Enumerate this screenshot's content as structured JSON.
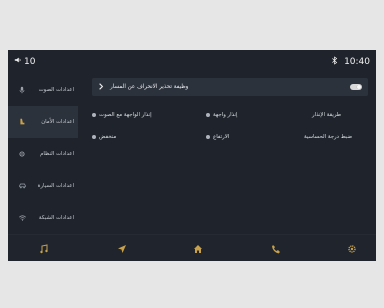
{
  "status": {
    "volume": "10",
    "time": "10:40",
    "icons": [
      "speaker-icon",
      "bluetooth-icon"
    ]
  },
  "sidebar": {
    "items": [
      {
        "label": "اعدادات الصوت",
        "icon": "microphone-icon",
        "active": false
      },
      {
        "label": "اعدادات الأمان",
        "icon": "seat-icon",
        "active": true
      },
      {
        "label": "اعدادات النظام",
        "icon": "gear-icon",
        "active": false
      },
      {
        "label": "اعدادات السيارة",
        "icon": "car-icon",
        "active": false
      },
      {
        "label": "اعدادات الشبكة",
        "icon": "wifi-icon",
        "active": false
      }
    ]
  },
  "main": {
    "toggle": {
      "label": "وظيفة تحذير الانحراف عن المسار",
      "state": "on"
    },
    "rows": [
      {
        "title": "طريقة الإنذار",
        "options": [
          "إنذار واجهة",
          "إنذار الواجهة مع الصوت"
        ]
      },
      {
        "title": "ضبط درجة الحساسية",
        "options": [
          "الارتفاع",
          "منخفض"
        ]
      }
    ]
  },
  "bottom_nav": [
    {
      "icon": "music-icon"
    },
    {
      "icon": "navigation-icon"
    },
    {
      "icon": "home-icon"
    },
    {
      "icon": "phone-icon"
    },
    {
      "icon": "gear-icon"
    }
  ],
  "colors": {
    "screen_bg": "#1f242c",
    "panel_bg": "#2c323b",
    "text": "#d9dce2"
  }
}
